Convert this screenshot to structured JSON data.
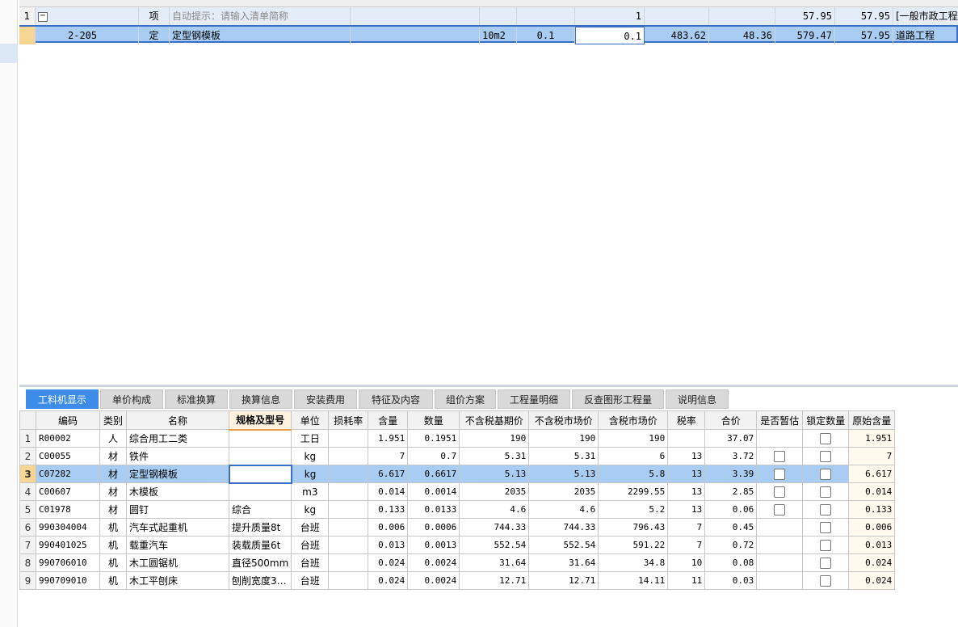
{
  "top": {
    "rows": [
      {
        "num": "1",
        "code": "",
        "type": "项",
        "name": "自动提示：请输入清单简称",
        "unit": "",
        "content": "",
        "qty": "1",
        "unit_price": "",
        "x1": "",
        "total_price": "57.95",
        "total": "57.95",
        "major": "[一般市政工程"
      },
      {
        "num": "",
        "code": "2-205",
        "type": "定",
        "name": "定型钢模板",
        "unit": "10m2",
        "content": "0.1",
        "qty": "0.1",
        "unit_price": "483.62",
        "x1": "48.36",
        "total_price": "579.47",
        "total": "57.95",
        "major": "道路工程"
      }
    ]
  },
  "tabs": [
    "工料机显示",
    "单价构成",
    "标准换算",
    "换算信息",
    "安装费用",
    "特征及内容",
    "组价方案",
    "工程量明细",
    "反查图形工程量",
    "说明信息"
  ],
  "columns": [
    "编码",
    "类别",
    "名称",
    "规格及型号",
    "单位",
    "损耗率",
    "含量",
    "数量",
    "不含税基期价",
    "不含税市场价",
    "含税市场价",
    "税率",
    "合价",
    "是否暂估",
    "锁定数量",
    "原始含量"
  ],
  "rows": [
    {
      "num": "1",
      "code": "R00002",
      "cat": "人",
      "name": "综合用工二类",
      "spec": "",
      "unit": "工日",
      "loss": "",
      "content": "1.951",
      "qty": "0.1951",
      "base_price": "190",
      "market_price": "190",
      "tax_price": "190",
      "tax_rate": "",
      "total": "37.07",
      "temp": false,
      "lock": true,
      "orig": "1.951"
    },
    {
      "num": "2",
      "code": "C00055",
      "cat": "材",
      "name": "铁件",
      "spec": "",
      "unit": "kg",
      "loss": "",
      "content": "7",
      "qty": "0.7",
      "base_price": "5.31",
      "market_price": "5.31",
      "tax_price": "6",
      "tax_rate": "13",
      "total": "3.72",
      "temp": true,
      "lock": true,
      "orig": "7"
    },
    {
      "num": "3",
      "code": "C07282",
      "cat": "材",
      "name": "定型钢模板",
      "spec": "",
      "unit": "kg",
      "loss": "",
      "content": "6.617",
      "qty": "0.6617",
      "base_price": "5.13",
      "market_price": "5.13",
      "tax_price": "5.8",
      "tax_rate": "13",
      "total": "3.39",
      "temp": true,
      "lock": true,
      "orig": "6.617"
    },
    {
      "num": "4",
      "code": "C00607",
      "cat": "材",
      "name": "木模板",
      "spec": "",
      "unit": "m3",
      "loss": "",
      "content": "0.014",
      "qty": "0.0014",
      "base_price": "2035",
      "market_price": "2035",
      "tax_price": "2299.55",
      "tax_rate": "13",
      "total": "2.85",
      "temp": true,
      "lock": true,
      "orig": "0.014"
    },
    {
      "num": "5",
      "code": "C01978",
      "cat": "材",
      "name": "圆钉",
      "spec": "综合",
      "unit": "kg",
      "loss": "",
      "content": "0.133",
      "qty": "0.0133",
      "base_price": "4.6",
      "market_price": "4.6",
      "tax_price": "5.2",
      "tax_rate": "13",
      "total": "0.06",
      "temp": true,
      "lock": true,
      "orig": "0.133"
    },
    {
      "num": "6",
      "code": "990304004",
      "cat": "机",
      "name": "汽车式起重机",
      "spec": "提升质量8t",
      "unit": "台班",
      "loss": "",
      "content": "0.006",
      "qty": "0.0006",
      "base_price": "744.33",
      "market_price": "744.33",
      "tax_price": "796.43",
      "tax_rate": "7",
      "total": "0.45",
      "temp": false,
      "lock": true,
      "orig": "0.006"
    },
    {
      "num": "7",
      "code": "990401025",
      "cat": "机",
      "name": "载重汽车",
      "spec": "装载质量6t",
      "unit": "台班",
      "loss": "",
      "content": "0.013",
      "qty": "0.0013",
      "base_price": "552.54",
      "market_price": "552.54",
      "tax_price": "591.22",
      "tax_rate": "7",
      "total": "0.72",
      "temp": false,
      "lock": true,
      "orig": "0.013"
    },
    {
      "num": "8",
      "code": "990706010",
      "cat": "机",
      "name": "木工圆锯机",
      "spec": "直径500mm",
      "unit": "台班",
      "loss": "",
      "content": "0.024",
      "qty": "0.0024",
      "base_price": "31.64",
      "market_price": "31.64",
      "tax_price": "34.8",
      "tax_rate": "10",
      "total": "0.08",
      "temp": false,
      "lock": true,
      "orig": "0.024"
    },
    {
      "num": "9",
      "code": "990709010",
      "cat": "机",
      "name": "木工平刨床",
      "spec": "刨削宽度3…",
      "unit": "台班",
      "loss": "",
      "content": "0.024",
      "qty": "0.0024",
      "base_price": "12.71",
      "market_price": "12.71",
      "tax_price": "14.11",
      "tax_rate": "11",
      "total": "0.03",
      "temp": false,
      "lock": true,
      "orig": "0.024"
    }
  ],
  "selected_row": "3",
  "colors": {
    "accent": "#3c8ce8",
    "selection": "#a9cdf2",
    "selected_row_num": "#f7d694"
  }
}
